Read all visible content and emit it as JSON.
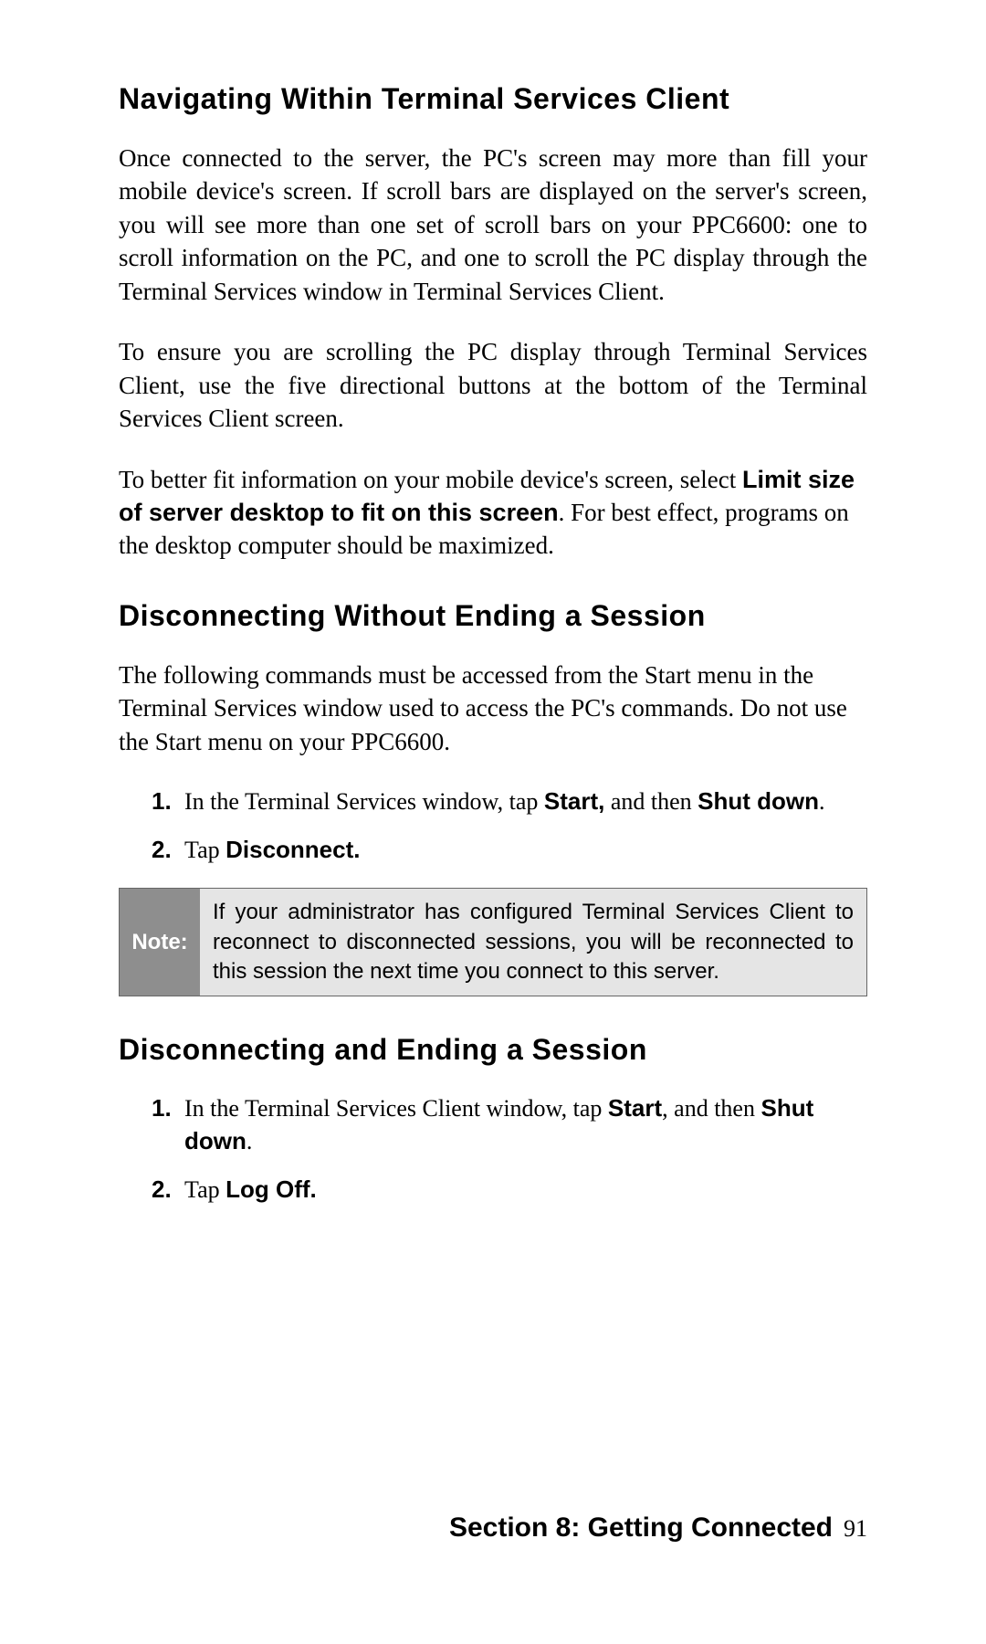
{
  "sections": [
    {
      "heading": "Navigating Within Terminal Services Client",
      "paragraphs": [
        {
          "text": "Once connected to the server, the PC's screen may more than fill your mobile device's screen. If scroll bars are displayed on the server's screen, you will see more than one set of scroll bars on your PPC6600: one to scroll information on the PC, and one to scroll the PC display through the Terminal Services window in Terminal Services Client.",
          "justify": true
        },
        {
          "text": "To ensure you are scrolling the PC display through Terminal Services Client, use the five directional buttons at the bottom of the Terminal Services Client screen.",
          "justify": true
        },
        {
          "pre": "To better fit information on your mobile device's screen, select ",
          "bold": "Limit size of server desktop to fit on this screen",
          "post": ". For best effect, programs on the desktop computer should be maximized.",
          "justify": false
        }
      ]
    },
    {
      "heading": "Disconnecting Without Ending a Session",
      "intro": "The following commands must be accessed from the Start menu in the Terminal Services window used to access the PC's commands. Do not use the Start menu on your PPC6600.",
      "steps": [
        {
          "pre": "In the Terminal Services window, tap ",
          "bold1": "Start,",
          "mid": " and then ",
          "bold2": "Shut down",
          "post": "."
        },
        {
          "pre": "Tap ",
          "bold1": "Disconnect.",
          "mid": "",
          "bold2": "",
          "post": ""
        }
      ],
      "note": {
        "label": "Note:",
        "text": "If your administrator has configured Terminal Services Client to reconnect to disconnected sessions, you will be reconnected to this session the next time you connect to this server."
      }
    },
    {
      "heading": "Disconnecting and Ending a Session",
      "steps": [
        {
          "pre": "In the Terminal Services Client window, tap ",
          "bold1": "Start",
          "mid": ", and then ",
          "bold2": "Shut down",
          "post": "."
        },
        {
          "pre": "Tap ",
          "bold1": "Log Off.",
          "mid": "",
          "bold2": "",
          "post": ""
        }
      ]
    }
  ],
  "footer": {
    "section_label": "Section 8: Getting Connected",
    "page_number": "91"
  }
}
